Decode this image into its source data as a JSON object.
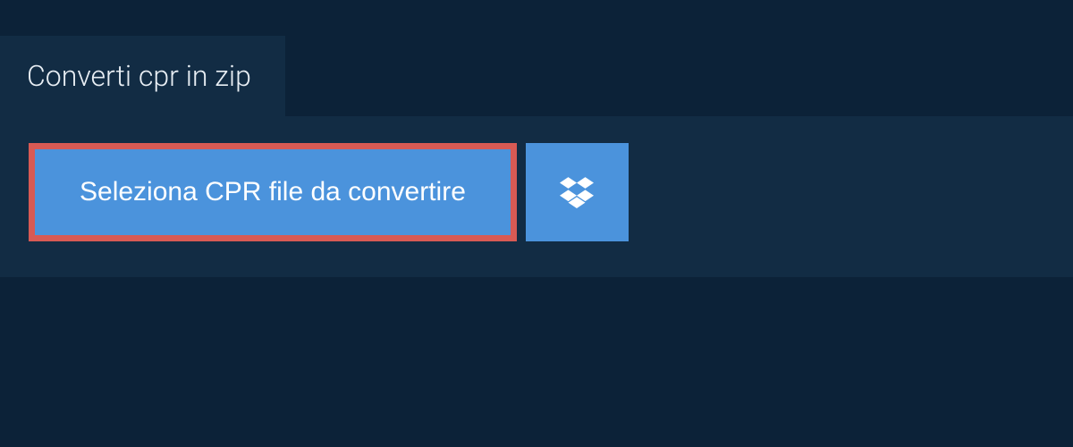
{
  "tab": {
    "label": "Converti cpr in zip"
  },
  "actions": {
    "select_file_label": "Seleziona CPR file da convertire"
  }
}
